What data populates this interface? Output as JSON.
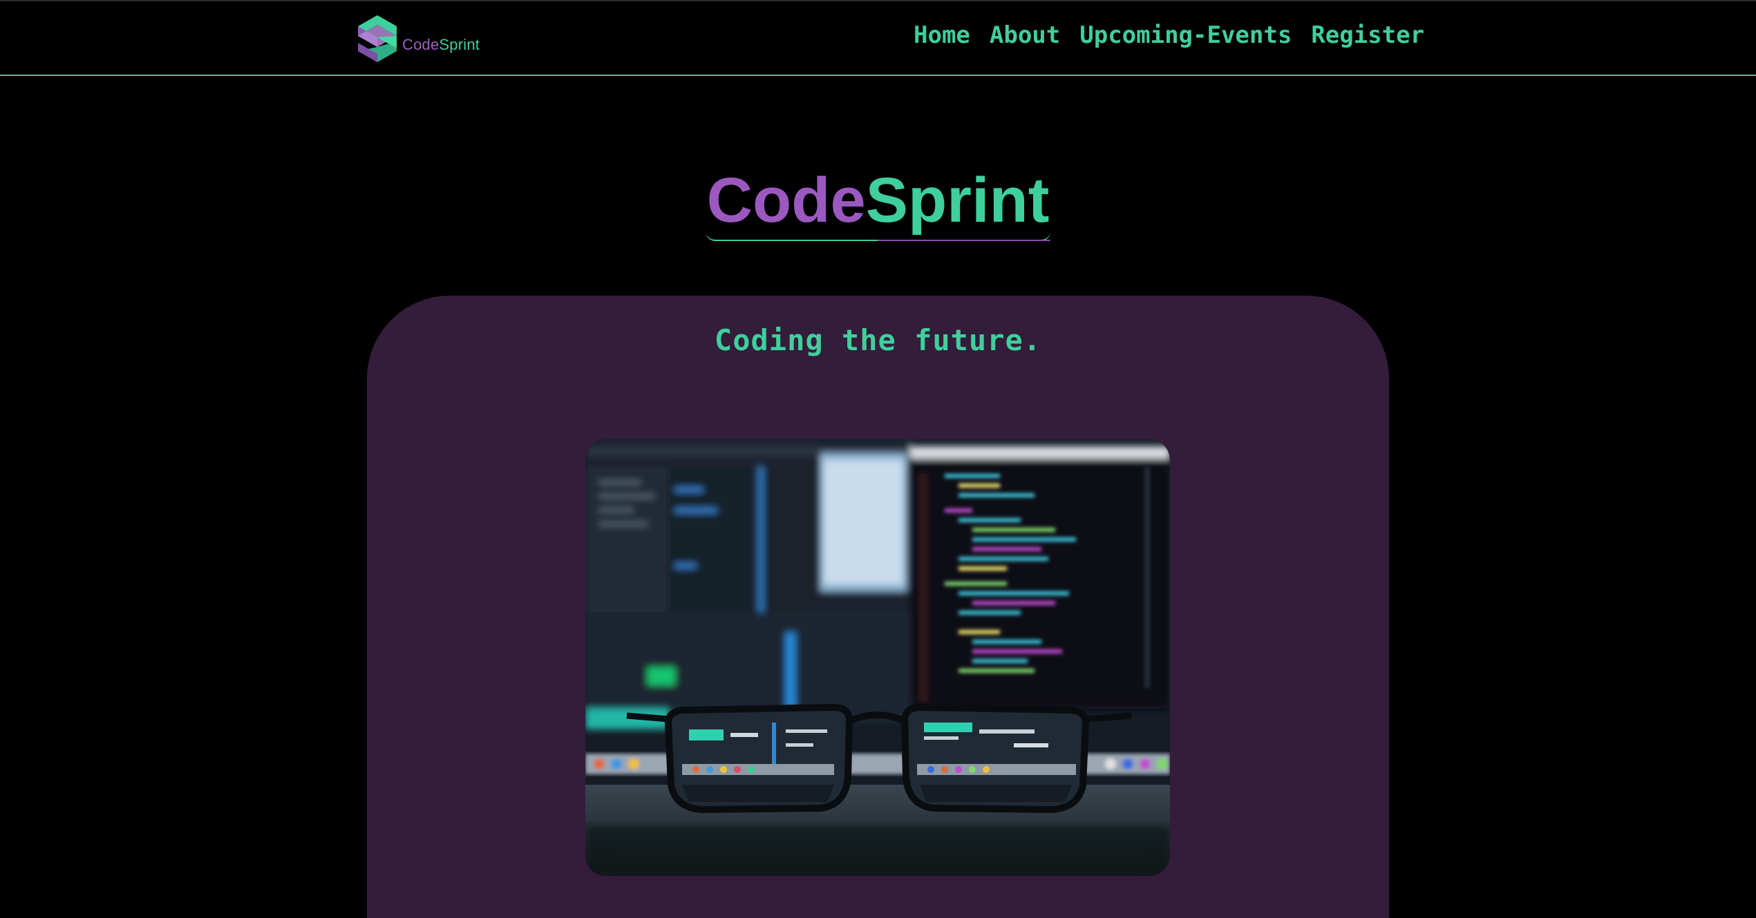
{
  "brand": {
    "logo_icon": "codesprint-logo-icon",
    "name_part1": "Code",
    "name_part2": "Sprint"
  },
  "nav": {
    "items": [
      {
        "label": "Home"
      },
      {
        "label": "About"
      },
      {
        "label": "Upcoming-Events"
      },
      {
        "label": "Register"
      }
    ]
  },
  "hero": {
    "title_part1": "Code",
    "title_part2": "Sprint",
    "tagline": "Coding the future.",
    "image": {
      "alt": "Eyeglasses in front of computer monitors displaying code"
    }
  },
  "colors": {
    "background": "#000000",
    "accent_green": "#3fcf9c",
    "accent_purple": "#9b59c0",
    "card_purple": "#341c3b"
  }
}
